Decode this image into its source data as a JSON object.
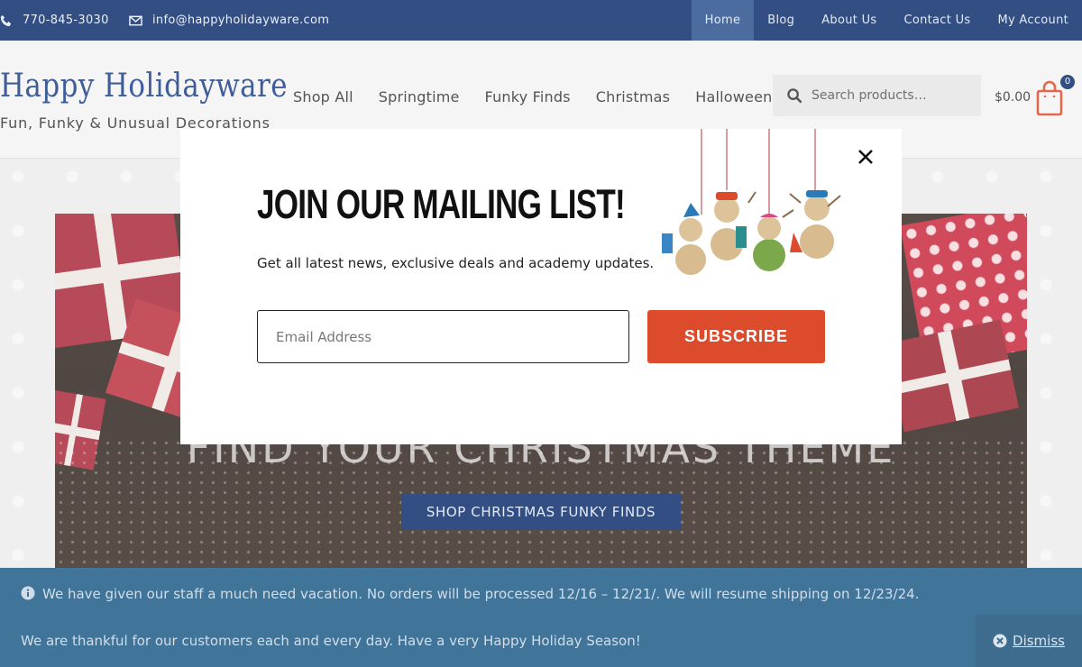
{
  "topbar": {
    "phone": "770-845-3030",
    "email": "info@happyholidayware.com",
    "nav": [
      "Home",
      "Blog",
      "About Us",
      "Contact Us",
      "My Account"
    ]
  },
  "header": {
    "logo_title": "Happy Holidayware",
    "logo_tagline": "Fun, Funky & Unusual Decorations",
    "nav": [
      "Shop All",
      "Springtime",
      "Funky Finds",
      "Christmas",
      "Halloween"
    ],
    "search_placeholder": "Search products…",
    "cart_total": "$0.00",
    "cart_count": "0"
  },
  "hero": {
    "title": "FIND YOUR CHRISTMAS THEME",
    "button": "SHOP CHRISTMAS FUNKY FINDS"
  },
  "modal": {
    "title": "JOIN OUR MAILING LIST!",
    "subtitle": "Get all latest news, exclusive deals and academy updates.",
    "email_placeholder": "Email Address",
    "subscribe": "SUBSCRIBE"
  },
  "notice": {
    "line1": "We have given our staff a much need vacation. No orders will be processed 12/16 – 12/21/. We will resume shipping on 12/23/24.",
    "line2": "We are thankful for our customers each and every day. Have a very Happy Holiday Season!",
    "dismiss": "Dismiss"
  },
  "colors": {
    "topbar": "#0b2d6b",
    "accent": "#dc4b2c",
    "notice": "#1d5a86"
  }
}
